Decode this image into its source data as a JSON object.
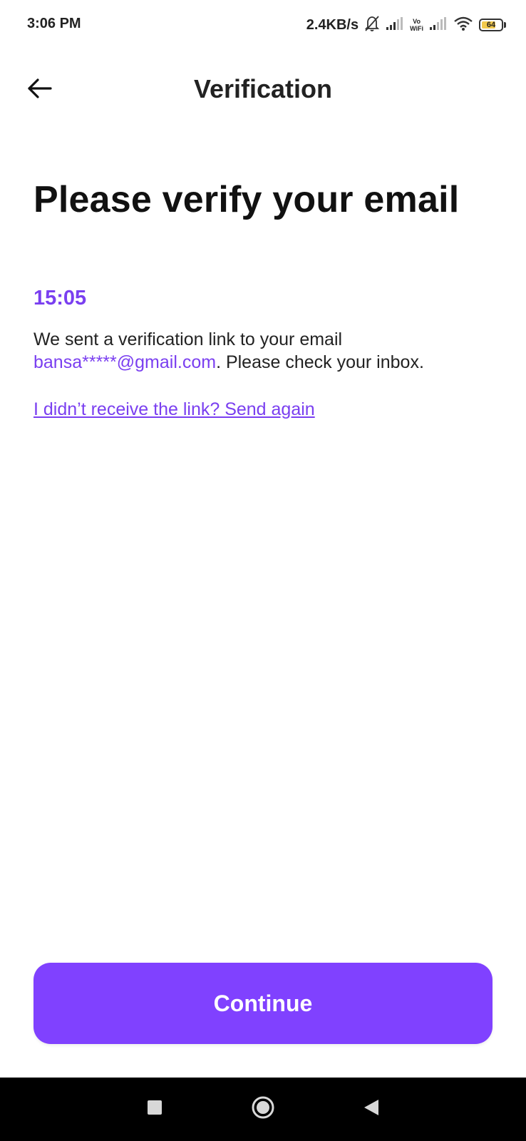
{
  "status_bar": {
    "time": "3:06 PM",
    "net_speed": "2.4KB/s",
    "vowifi_top": "Vo",
    "vowifi_bottom": "WiFi",
    "battery_level": "64",
    "icons": [
      "bell-off-icon",
      "signal-icon",
      "vowifi-icon",
      "signal-icon",
      "wifi-icon",
      "battery-icon"
    ]
  },
  "app_bar": {
    "back_icon": "arrow-left-icon",
    "title": "Verification"
  },
  "content": {
    "heading": "Please verify your email",
    "timer": "15:05",
    "info_prefix": "We sent a verification link to your email ",
    "email": "bansa*****@gmail.com",
    "info_suffix": ". Please check your inbox.",
    "resend_link": "I didn’t receive the link? Send again"
  },
  "actions": {
    "continue_label": "Continue"
  },
  "colors": {
    "accent": "#8041ff",
    "accent_text": "#7a3ff0",
    "nav_bar": "#000000"
  },
  "nav_bar": {
    "icons": [
      "recent-apps-icon",
      "home-icon",
      "back-icon"
    ]
  }
}
